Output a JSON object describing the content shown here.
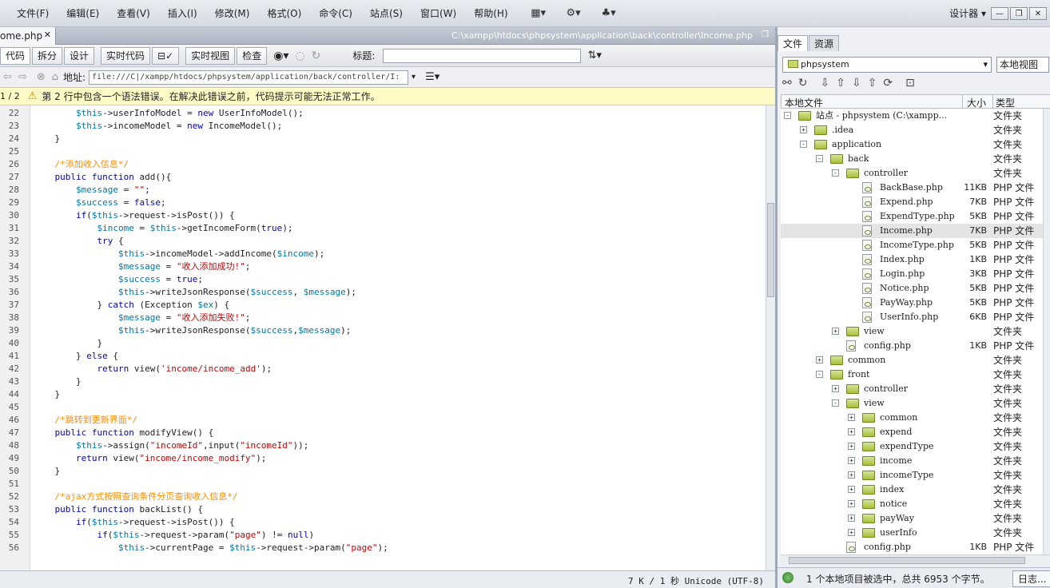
{
  "menu": {
    "items": [
      "文件(F)",
      "编辑(E)",
      "查看(V)",
      "插入(I)",
      "修改(M)",
      "格式(O)",
      "命令(C)",
      "站点(S)",
      "窗口(W)",
      "帮助(H)"
    ],
    "designer": "设计器 ▾"
  },
  "doc": {
    "tab_label": "ome.php",
    "path": "C:\\xampp\\htdocs\\phpsystem\\application\\back\\controller\\Income.php"
  },
  "viewbar": {
    "code": "代码",
    "split": "拆分",
    "design": "设计",
    "live_code": "实时代码",
    "live_view": "实时视图",
    "inspect": "检查",
    "title_label": "标题:"
  },
  "address": {
    "label": "地址:",
    "value": "file:///C|/xampp/htdocs/phpsystem/application/back/controller/I:"
  },
  "warning": {
    "counter": "1 / 2",
    "text": "第 2 行中包含一个语法错误。在解决此错误之前，代码提示可能无法正常工作。"
  },
  "code_lines": [
    {
      "n": "22",
      "t": "        $this->userInfoModel = new UserInfoModel();"
    },
    {
      "n": "23",
      "t": "        $this->incomeModel = new IncomeModel();"
    },
    {
      "n": "24",
      "t": "    }"
    },
    {
      "n": "25",
      "t": ""
    },
    {
      "n": "26",
      "t": "    /*添加收入信息*/"
    },
    {
      "n": "27",
      "t": "    public function add(){"
    },
    {
      "n": "28",
      "t": "        $message = \"\";"
    },
    {
      "n": "29",
      "t": "        $success = false;"
    },
    {
      "n": "30",
      "t": "        if($this->request->isPost()) {"
    },
    {
      "n": "31",
      "t": "            $income = $this->getIncomeForm(true);"
    },
    {
      "n": "32",
      "t": "            try {"
    },
    {
      "n": "33",
      "t": "                $this->incomeModel->addIncome($income);"
    },
    {
      "n": "34",
      "t": "                $message = \"收入添加成功!\";"
    },
    {
      "n": "35",
      "t": "                $success = true;"
    },
    {
      "n": "36",
      "t": "                $this->writeJsonResponse($success, $message);"
    },
    {
      "n": "37",
      "t": "            } catch (Exception $ex) {"
    },
    {
      "n": "38",
      "t": "                $message = \"收入添加失败!\";"
    },
    {
      "n": "39",
      "t": "                $this->writeJsonResponse($success,$message);"
    },
    {
      "n": "40",
      "t": "            }"
    },
    {
      "n": "41",
      "t": "        } else {"
    },
    {
      "n": "42",
      "t": "            return view('income/income_add');"
    },
    {
      "n": "43",
      "t": "        }"
    },
    {
      "n": "44",
      "t": "    }"
    },
    {
      "n": "45",
      "t": ""
    },
    {
      "n": "46",
      "t": "    /*跳转到更新界面*/"
    },
    {
      "n": "47",
      "t": "    public function modifyView() {"
    },
    {
      "n": "48",
      "t": "        $this->assign(\"incomeId\",input(\"incomeId\"));"
    },
    {
      "n": "49",
      "t": "        return view(\"income/income_modify\");"
    },
    {
      "n": "50",
      "t": "    }"
    },
    {
      "n": "51",
      "t": ""
    },
    {
      "n": "52",
      "t": "    /*ajax方式按照查询条件分页查询收入信息*/"
    },
    {
      "n": "53",
      "t": "    public function backList() {"
    },
    {
      "n": "54",
      "t": "        if($this->request->isPost()) {"
    },
    {
      "n": "55",
      "t": "            if($this->request->param(\"page\") != null)"
    },
    {
      "n": "56",
      "t": "                $this->currentPage = $this->request->param(\"page\");"
    }
  ],
  "editor_status": "7 K / 1 秒  Unicode (UTF-8)",
  "right": {
    "tab_files": "文件",
    "tab_assets": "资源",
    "site": "phpsystem",
    "view": "本地视图",
    "col_local": "本地文件",
    "col_size": "大小",
    "col_type": "类型",
    "status": "1 个本地项目被选中，总共 6953 个字节。",
    "log": "日志..."
  },
  "tree": [
    {
      "name": "站点 - phpsystem (C:\\xampp...",
      "size": "",
      "type": "文件夹",
      "extra": "2"
    },
    {
      "name": ".idea",
      "size": "",
      "type": "文件夹",
      "extra": "2"
    },
    {
      "name": "application",
      "size": "",
      "type": "文件夹",
      "extra": "2"
    },
    {
      "name": "back",
      "size": "",
      "type": "文件夹",
      "extra": "2"
    },
    {
      "name": "controller",
      "size": "",
      "type": "文件夹",
      "extra": "2"
    },
    {
      "name": "BackBase.php",
      "size": "11KB",
      "type": "PHP 文件",
      "extra": "2"
    },
    {
      "name": "Expend.php",
      "size": "7KB",
      "type": "PHP 文件",
      "extra": "2"
    },
    {
      "name": "ExpendType.php",
      "size": "5KB",
      "type": "PHP 文件",
      "extra": "2"
    },
    {
      "name": "Income.php",
      "size": "7KB",
      "type": "PHP 文件",
      "extra": "2"
    },
    {
      "name": "IncomeType.php",
      "size": "5KB",
      "type": "PHP 文件",
      "extra": "2"
    },
    {
      "name": "Index.php",
      "size": "1KB",
      "type": "PHP 文件",
      "extra": "2"
    },
    {
      "name": "Login.php",
      "size": "3KB",
      "type": "PHP 文件",
      "extra": "2"
    },
    {
      "name": "Notice.php",
      "size": "5KB",
      "type": "PHP 文件",
      "extra": "2"
    },
    {
      "name": "PayWay.php",
      "size": "5KB",
      "type": "PHP 文件",
      "extra": "2"
    },
    {
      "name": "UserInfo.php",
      "size": "6KB",
      "type": "PHP 文件",
      "extra": "2"
    },
    {
      "name": "view",
      "size": "",
      "type": "文件夹",
      "extra": "2"
    },
    {
      "name": "config.php",
      "size": "1KB",
      "type": "PHP 文件",
      "extra": "2"
    },
    {
      "name": "common",
      "size": "",
      "type": "文件夹",
      "extra": "2"
    },
    {
      "name": "front",
      "size": "",
      "type": "文件夹",
      "extra": "2"
    },
    {
      "name": "controller",
      "size": "",
      "type": "文件夹",
      "extra": "2"
    },
    {
      "name": "view",
      "size": "",
      "type": "文件夹",
      "extra": "2"
    },
    {
      "name": "common",
      "size": "",
      "type": "文件夹",
      "extra": "2"
    },
    {
      "name": "expend",
      "size": "",
      "type": "文件夹",
      "extra": "2"
    },
    {
      "name": "expendType",
      "size": "",
      "type": "文件夹",
      "extra": "2"
    },
    {
      "name": "income",
      "size": "",
      "type": "文件夹",
      "extra": "2"
    },
    {
      "name": "incomeType",
      "size": "",
      "type": "文件夹",
      "extra": "2"
    },
    {
      "name": "index",
      "size": "",
      "type": "文件夹",
      "extra": "2"
    },
    {
      "name": "notice",
      "size": "",
      "type": "文件夹",
      "extra": "2"
    },
    {
      "name": "payWay",
      "size": "",
      "type": "文件夹",
      "extra": "2"
    },
    {
      "name": "userInfo",
      "size": "",
      "type": "文件夹",
      "extra": "2"
    },
    {
      "name": "config.php",
      "size": "1KB",
      "type": "PHP 文件",
      "extra": "2"
    }
  ]
}
